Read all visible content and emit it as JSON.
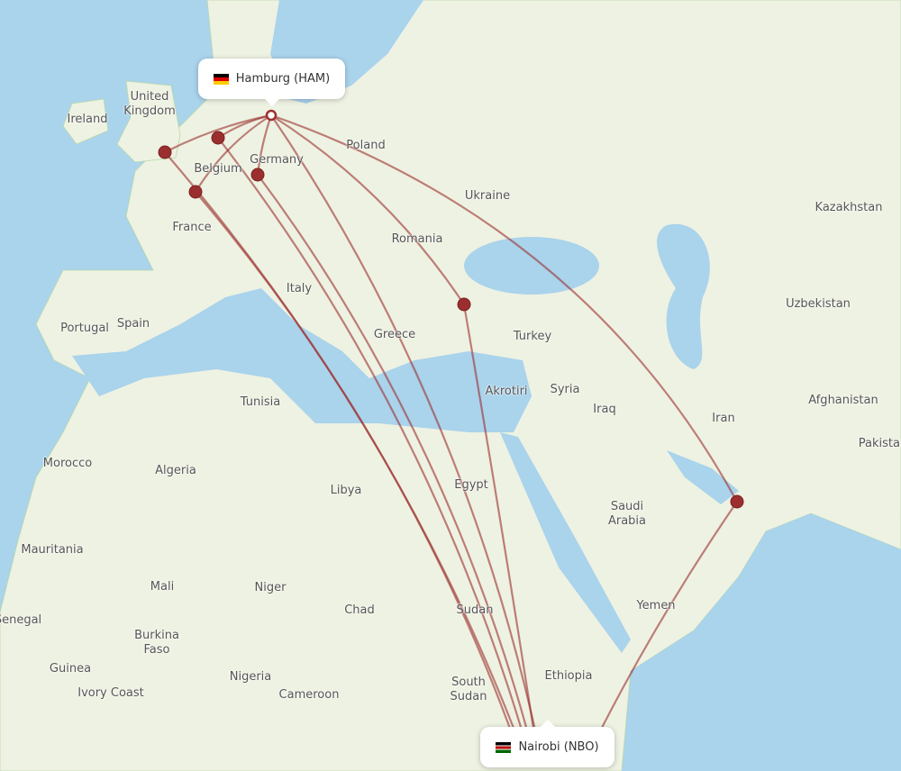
{
  "origin": {
    "name": "Hamburg (HAM)",
    "flag": "flag-germany"
  },
  "destination": {
    "name": "Nairobi (NBO)",
    "flag": "flag-kenya"
  },
  "colors": {
    "route": "#9b2f2f",
    "land": "#eef2e2",
    "sea": "#aad3ec",
    "marker": "#9b2f2f"
  },
  "labels": [
    "Ireland",
    "United Kingdom",
    "Belgium",
    "Germany",
    "Poland",
    "Ukraine",
    "Kazakhstan",
    "France",
    "Romania",
    "Uzbekistan",
    "Italy",
    "Portugal",
    "Spain",
    "Greece",
    "Turkey",
    "Akrotiri",
    "Syria",
    "Tunisia",
    "Iraq",
    "Iran",
    "Afghanistan",
    "Pakistan",
    "Morocco",
    "Algeria",
    "Libya",
    "Egypt",
    "Saudi Arabia",
    "Mauritania",
    "Mali",
    "Niger",
    "Chad",
    "Sudan",
    "Yemen",
    "Senegal",
    "Burkina Faso",
    "Guinea",
    "Nigeria",
    "Ethiopia",
    "Ivory Coast",
    "Cameroon",
    "South Sudan"
  ]
}
